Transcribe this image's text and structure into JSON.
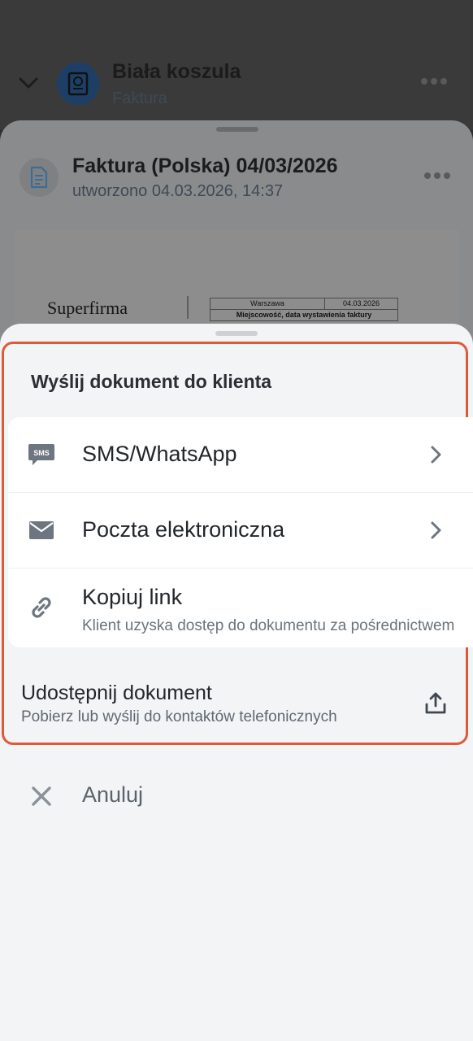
{
  "header": {
    "title": "Biała koszula",
    "subtitle": "Faktura"
  },
  "document": {
    "title": "Faktura (Polska) 04/03/2026",
    "subtitle": "utworzono 04.03.2026, 14:37",
    "preview": {
      "brand": "Superfirma",
      "place": "Warszawa",
      "date": "04.03.2026",
      "caption": "Miejscowość, data wystawienia faktury"
    }
  },
  "sheet": {
    "title": "Wyślij dokument do klienta",
    "options": [
      {
        "label": "SMS/WhatsApp",
        "icon": "sms-icon"
      },
      {
        "label": "Poczta elektroniczna",
        "icon": "mail-icon"
      },
      {
        "label": "Kopiuj link",
        "sublabel": "Klient uzyska dostęp do dokumentu za pośrednictwem",
        "icon": "link-icon"
      }
    ],
    "share": {
      "label": "Udostępnij dokument",
      "sublabel": "Pobierz lub wyślij do kontaktów telefonicznych",
      "icon": "share-upload-icon"
    },
    "cancel": {
      "label": "Anuluj",
      "icon": "close-icon"
    }
  },
  "colors": {
    "highlight_border": "#e05a3a",
    "sheet_background": "#f3f4f6",
    "icon_gray": "#6c7580"
  }
}
